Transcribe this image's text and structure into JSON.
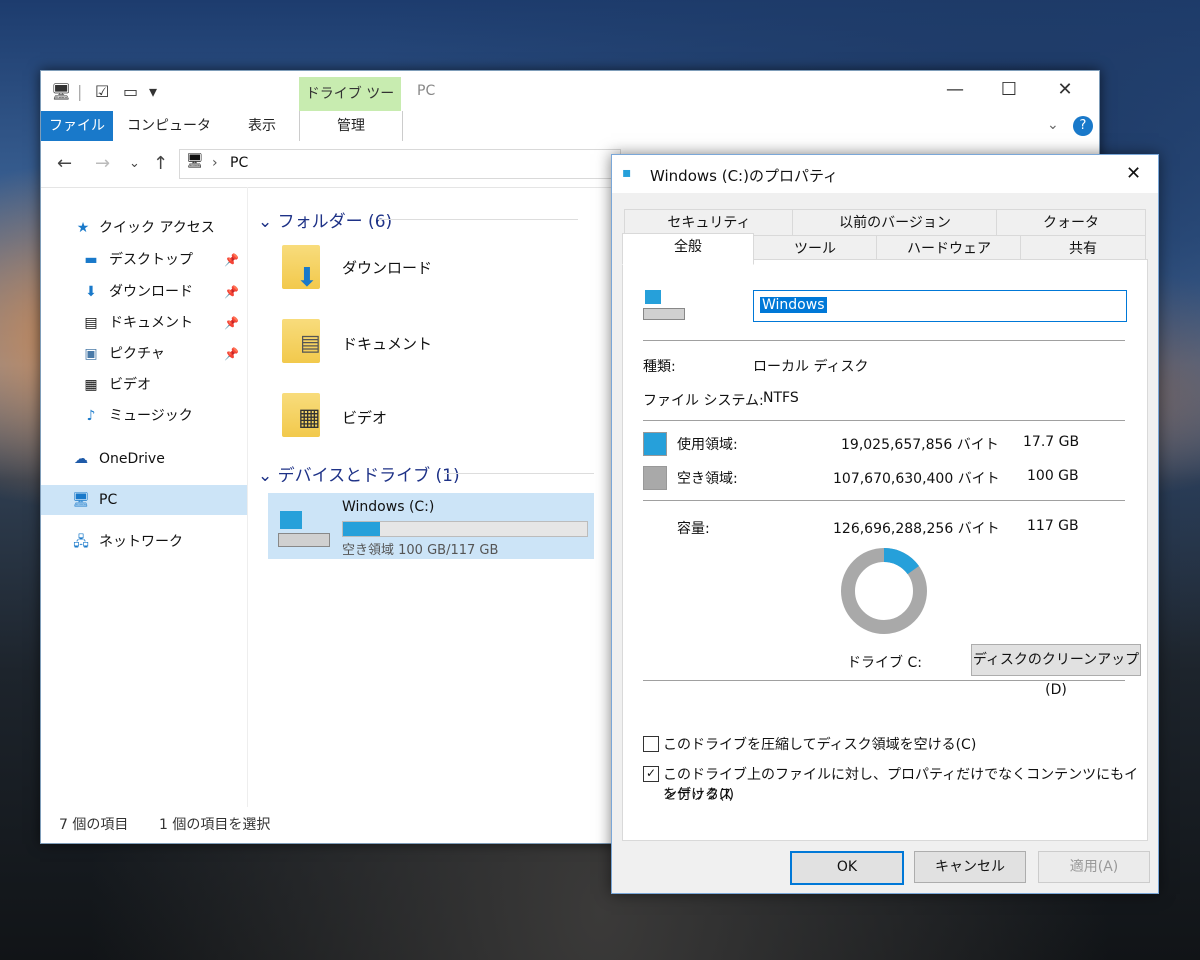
{
  "explorer": {
    "ribbon_tabs": [
      "ファイル",
      "コンピューター",
      "表示",
      "管理"
    ],
    "context_tab": "ドライブ ツール",
    "window_title": "PC",
    "address": "PC",
    "sidebar": {
      "quick_access": "クイック アクセス",
      "items": [
        "デスクトップ",
        "ダウンロード",
        "ドキュメント",
        "ピクチャ",
        "ビデオ",
        "ミュージック"
      ],
      "onedrive": "OneDrive",
      "pc": "PC",
      "network": "ネットワーク"
    },
    "folders_header": "フォルダー (6)",
    "folders": [
      "ダウンロード",
      "ドキュメント",
      "ビデオ"
    ],
    "devices_header": "デバイスとドライブ (1)",
    "drive": {
      "name": "Windows (C:)",
      "free_text": "空き領域 100 GB/117 GB",
      "used_fraction": 0.151
    },
    "status": {
      "items": "7 個の項目",
      "selected": "1 個の項目を選択"
    }
  },
  "dialog": {
    "title": "Windows (C:)のプロパティ",
    "tabs_row1": [
      "セキュリティ",
      "以前のバージョン",
      "クォータ"
    ],
    "tabs_row2": [
      "全般",
      "ツール",
      "ハードウェア",
      "共有"
    ],
    "name_value": "Windows",
    "type_label": "種類:",
    "type_value": "ローカル ディスク",
    "fs_label": "ファイル システム:",
    "fs_value": "NTFS",
    "used_label": "使用領域:",
    "used_bytes": "19,025,657,856 バイト",
    "used_gb": "17.7 GB",
    "free_label": "空き領域:",
    "free_bytes": "107,670,630,400 バイト",
    "free_gb": "100 GB",
    "capacity_label": "容量:",
    "capacity_bytes": "126,696,288,256 バイト",
    "capacity_gb": "117 GB",
    "drive_label": "ドライブ C:",
    "cleanup_button": "ディスクのクリーンアップ(D)",
    "compress_label": "このドライブを圧縮してディスク領域を空ける(C)",
    "index_label_1": "このドライブ上のファイルに対し、プロパティだけでなくコンテンツにもインデックス",
    "index_label_2": "を付ける(I)",
    "compress_checked": false,
    "index_checked": true,
    "ok": "OK",
    "cancel": "キャンセル",
    "apply": "適用(A)",
    "colors": {
      "used": "#26a0da",
      "free": "#a9a9a9"
    },
    "used_fraction": 0.151
  }
}
